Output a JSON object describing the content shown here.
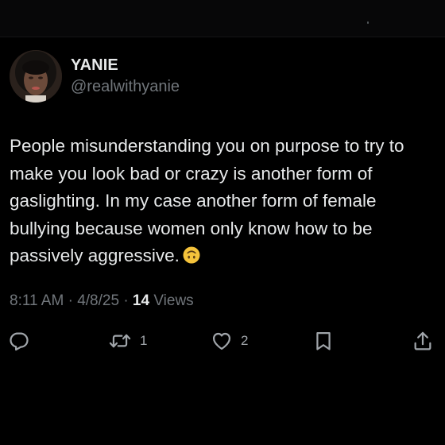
{
  "header": {},
  "author": {
    "display_name": "YANIE",
    "handle": "@realwithyanie",
    "avatar_icon": "profile-photo"
  },
  "tweet": {
    "text": "People misunderstanding you on purpose to try to make you look bad or crazy is another form of gaslighting. In my case another form of female bullying because women only know how to be passively aggressive.",
    "emoji_icon": "upside-down-face-emoji",
    "time": "8:11 AM",
    "date": "4/8/25",
    "separator": "·",
    "views_count": "14",
    "views_label": "Views"
  },
  "actions": {
    "reply": {
      "icon": "reply-icon"
    },
    "retweet": {
      "icon": "retweet-icon",
      "count": "1"
    },
    "like": {
      "icon": "heart-icon",
      "count": "2"
    },
    "bookmark": {
      "icon": "bookmark-icon"
    },
    "share": {
      "icon": "share-icon"
    }
  },
  "colors": {
    "background": "#000000",
    "primary_text": "#e7e9ea",
    "secondary_text": "#71767b",
    "icon": "#a0a5aa"
  }
}
